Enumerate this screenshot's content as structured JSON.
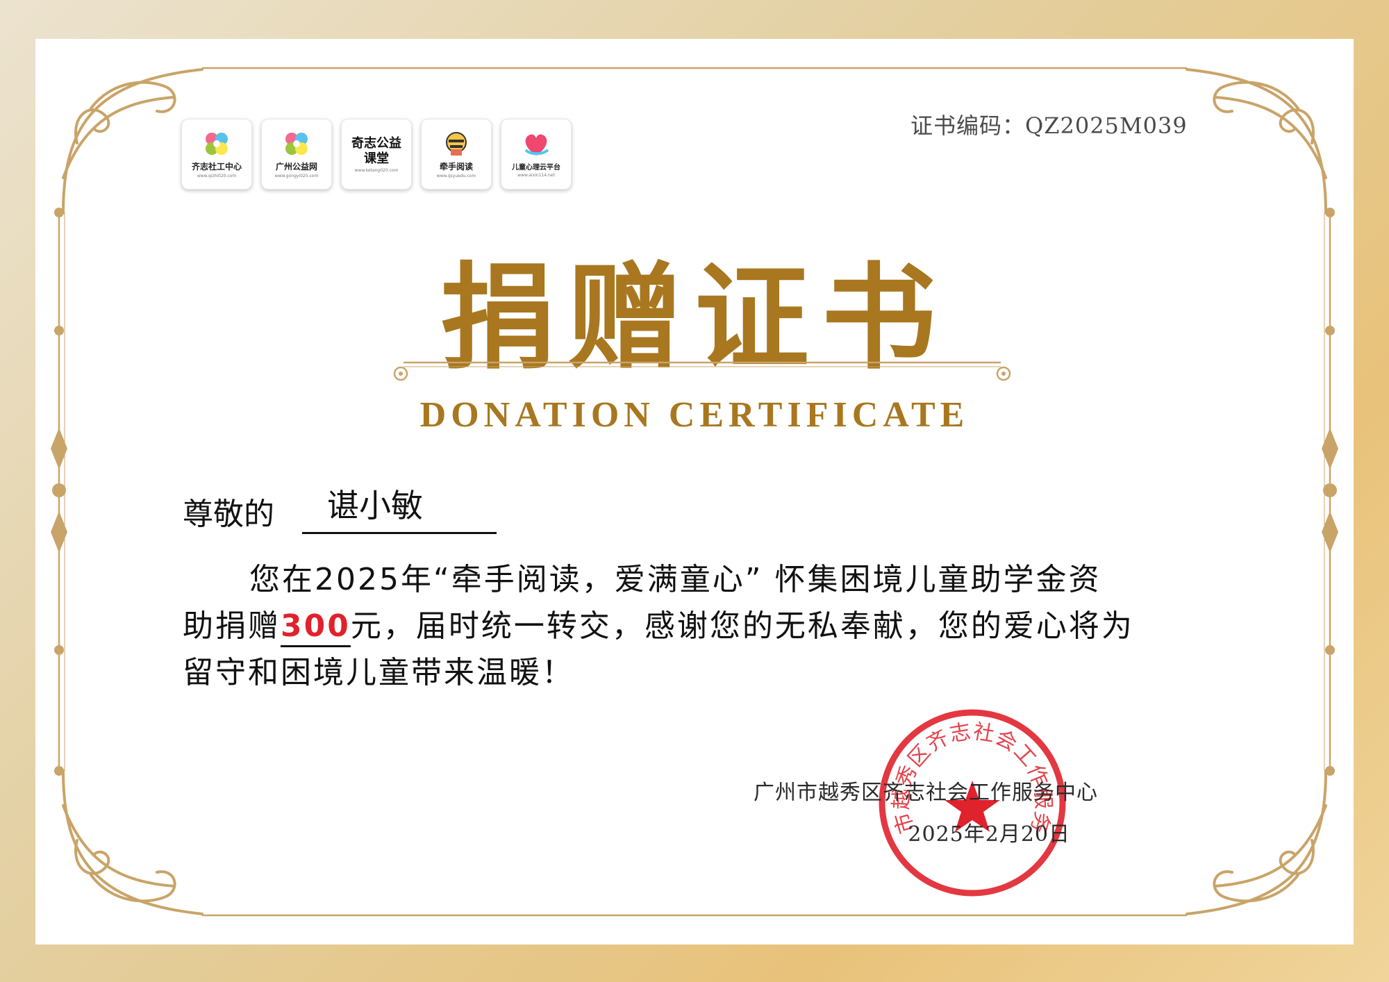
{
  "certificate": {
    "number_label": "证书编码：QZ2025M039",
    "title": "捐赠证书",
    "subtitle": "DONATION CERTIFICATE",
    "salutation": "尊敬的",
    "recipient": "谌小敏",
    "body_line1": "您在2025年“牵手阅读，爱满童心” 怀集困境儿童助学金资",
    "body_line2_prefix": "助捐赠",
    "amount": "300",
    "body_line2_suffix": "元，届时统一转交，感谢您的无私奉献，您的爱心将为",
    "body_line3": "留守和困境儿童带来温暖！",
    "organization": "广州市越秀区齐志社会工作服务中心",
    "date": "2025年2月20日"
  },
  "logos": [
    {
      "name": "齐志社工中心",
      "url": "www.qizhi020.com",
      "icon": "flower-logo-icon"
    },
    {
      "name": "广州公益网",
      "url": "www.gongyi020.com",
      "icon": "flower-logo-icon"
    },
    {
      "name": "奇志公益课堂",
      "url": "www.ketang020.com",
      "icon": "calligraphy-logo"
    },
    {
      "name": "牵手阅读",
      "url": "www.qsyuedu.com",
      "icon": "bee-reading-icon"
    },
    {
      "name": "儿童心理云平台",
      "url": "www.aixin114.net",
      "icon": "heart-hand-icon"
    }
  ],
  "seal": {
    "text": "广州市越秀区齐志社会工作服务中心",
    "color": "#e0222c"
  },
  "colors": {
    "gold": "#a8771f",
    "accent_red": "#e0222c"
  }
}
